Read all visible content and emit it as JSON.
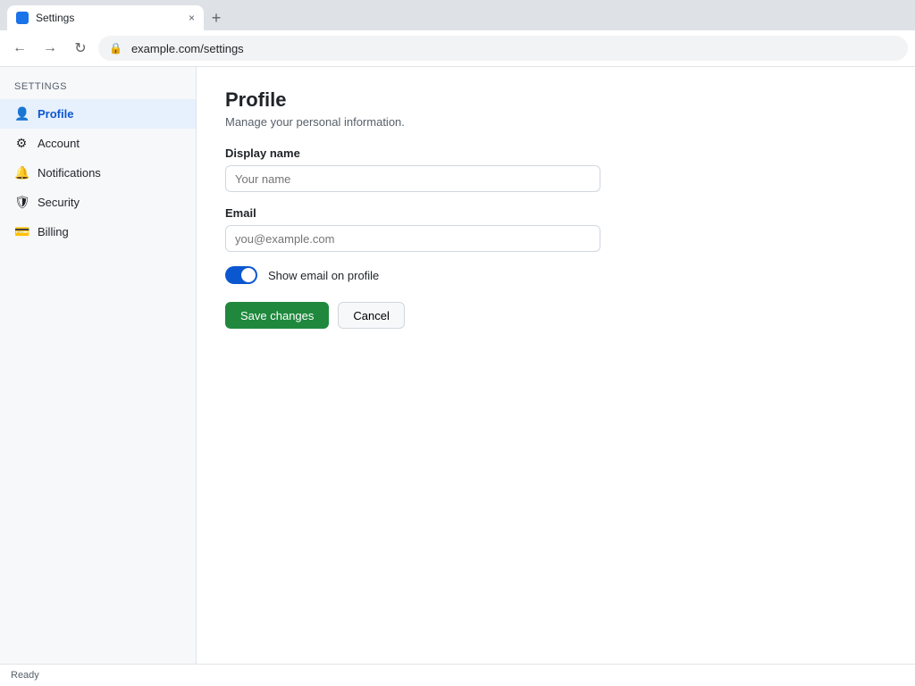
{
  "browser": {
    "tab_title": "Settings",
    "tab_close": "×",
    "new_tab": "+",
    "url": "example.com/settings"
  },
  "toolbar": {
    "back": "←",
    "forward": "→",
    "reload": "↻",
    "lock": "🔒"
  },
  "sidebar": {
    "heading": "Settings",
    "items": [
      {
        "label": "Profile",
        "icon": "person-icon",
        "glyph": "👤"
      },
      {
        "label": "Account",
        "icon": "gear-icon",
        "glyph": "⚙"
      },
      {
        "label": "Notifications",
        "icon": "bell-icon",
        "glyph": "🔔"
      },
      {
        "label": "Security",
        "icon": "shield-icon",
        "glyph": "🛡"
      },
      {
        "label": "Billing",
        "icon": "card-icon",
        "glyph": "💳"
      }
    ]
  },
  "main": {
    "title": "Profile",
    "subtitle": "Manage your personal information.",
    "name_label": "Display name",
    "name_value": "",
    "name_placeholder": "Your name",
    "email_label": "Email",
    "email_value": "",
    "email_placeholder": "you@example.com",
    "toggle_label": "Show email on profile",
    "save_label": "Save changes",
    "cancel_label": "Cancel"
  },
  "status": {
    "left": "Ready",
    "right": ""
  },
  "colors": {
    "accent": "#0b57d0",
    "primary_button": "#1f883d"
  }
}
